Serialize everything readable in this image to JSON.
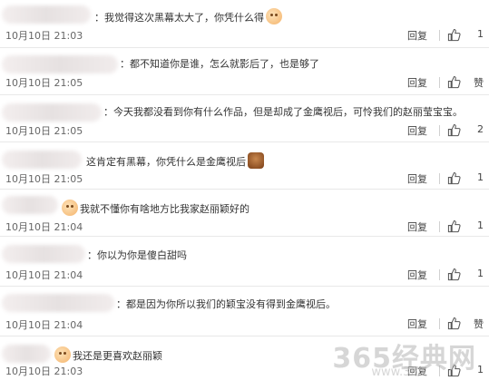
{
  "comments": [
    {
      "text": "：我觉得这次黑幕太大了，你凭什么得",
      "time": "10月10日 21:03",
      "reply": "回复",
      "likes": "1"
    },
    {
      "text": "：都不知道你是谁，怎么就影后了，也是够了",
      "time": "10月10日 21:05",
      "reply": "回复",
      "likes": "赞"
    },
    {
      "text": "：今天我都没看到你有什么作品，但是却成了金鹰视后，可怜我们的赵丽莹宝宝。",
      "time": "10月10日 21:05",
      "reply": "回复",
      "likes": "2"
    },
    {
      "text": "这肯定有黑幕，你凭什么是金鹰视后",
      "time": "10月10日 21:05",
      "reply": "回复",
      "likes": "1"
    },
    {
      "text": "我就不懂你有啥地方比我家赵丽颖好的",
      "time": "10月10日 21:04",
      "reply": "回复",
      "likes": "1"
    },
    {
      "text": "：你以为你是傻白甜吗",
      "time": "10月10日 21:04",
      "reply": "回复",
      "likes": "1"
    },
    {
      "text": "：都是因为你所以我们的颖宝没有得到金鹰视后。",
      "time": "10月10日 21:04",
      "reply": "回复",
      "likes": "赞"
    },
    {
      "text": "我还是更喜欢赵丽颖",
      "time": "10月10日 21:03",
      "reply": "回复",
      "likes": "1"
    }
  ],
  "icons": {
    "like": "thumbs-up-icon"
  },
  "watermark": {
    "logo": "365经典网",
    "url": "www.365"
  }
}
